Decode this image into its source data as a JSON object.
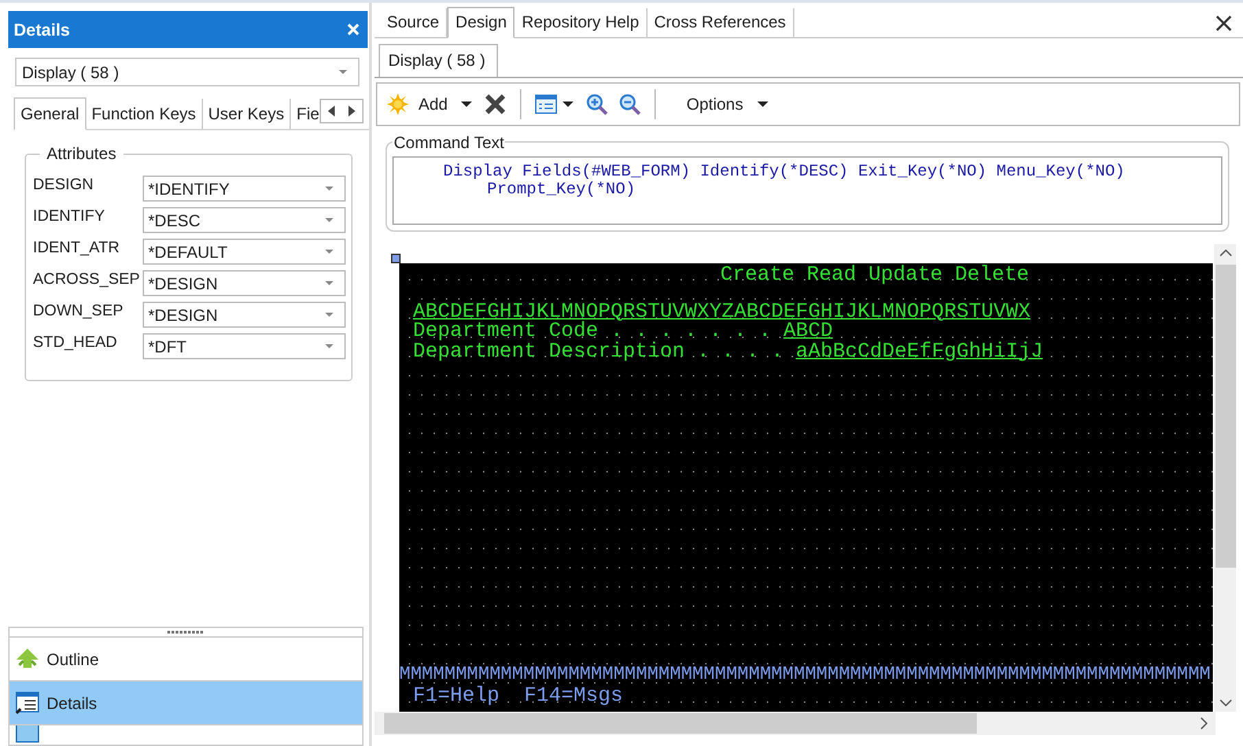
{
  "details_panel": {
    "title": "Details",
    "object_select": {
      "value": "Display ( 58 )"
    },
    "tabs": [
      {
        "label": "General",
        "selected": true
      },
      {
        "label": "Function Keys",
        "selected": false
      },
      {
        "label": "User Keys",
        "selected": false
      },
      {
        "label": "Fie",
        "selected": false
      }
    ],
    "attributes": {
      "title": "Attributes",
      "rows": [
        {
          "name": "DESIGN",
          "value": "*IDENTIFY"
        },
        {
          "name": "IDENTIFY",
          "value": "*DESC"
        },
        {
          "name": "IDENT_ATR",
          "value": "*DEFAULT"
        },
        {
          "name": "ACROSS_SEP",
          "value": "*DESIGN"
        },
        {
          "name": "DOWN_SEP",
          "value": "*DESIGN"
        },
        {
          "name": "STD_HEAD",
          "value": "*DFT"
        }
      ]
    }
  },
  "navigator": {
    "items": [
      {
        "kind": "outline",
        "label": "Outline",
        "selected": false
      },
      {
        "kind": "details",
        "label": "Details",
        "selected": true
      },
      {
        "kind": "window",
        "selected": false
      }
    ]
  },
  "editor": {
    "tabs": [
      {
        "label": "Source",
        "selected": false
      },
      {
        "label": "Design",
        "selected": true
      },
      {
        "label": "Repository Help",
        "selected": false
      },
      {
        "label": "Cross References",
        "selected": false
      }
    ],
    "sub_tabs": [
      {
        "label": "Display ( 58 )",
        "selected": true
      }
    ],
    "toolbar": {
      "add_label": "Add",
      "options_label": "Options"
    },
    "command_text": {
      "title": "Command Text",
      "lines": [
        "Display Fields(#WEB_FORM) Identify(*DESC) Exit_Key(*NO) Menu_Key(*NO)",
        "Prompt_Key(*NO)"
      ]
    },
    "screen": {
      "lines": [
        {
          "kind": "title",
          "segments": [
            {
              "text": "Create Read Update Delete",
              "kind": "plain"
            }
          ]
        },
        {
          "kind": "blank"
        },
        {
          "kind": "field",
          "segments": [
            {
              "text": "ABCDEFGHIJKLMNOPQRSTUVWXYZABCDEFGHIJKLMNOPQRSTUVWX",
              "kind": "field"
            }
          ]
        },
        {
          "kind": "field",
          "segments": [
            {
              "text": "Department Code . . . . . . .",
              "kind": "label"
            },
            {
              "text": "ABCD",
              "kind": "field"
            }
          ]
        },
        {
          "kind": "field",
          "segments": [
            {
              "text": "Department Description . . . .",
              "kind": "label"
            },
            {
              "text": "aAbBcCdDeEfFgGhHiIjJ",
              "kind": "field"
            }
          ]
        },
        {
          "kind": "gap"
        },
        {
          "kind": "message",
          "segments": [
            {
              "text": "MMMMMMMMMMMMMMMMMMMMMMMMMMMMMMMMMMMMMMMMMMMMMMMMMMMMMMMMMMMMMMMMMMMMMMMM",
              "kind": "plain"
            }
          ]
        },
        {
          "kind": "keys",
          "segments": [
            {
              "text": "F1=Help  F14=Msgs",
              "kind": "plain"
            }
          ]
        }
      ]
    }
  }
}
